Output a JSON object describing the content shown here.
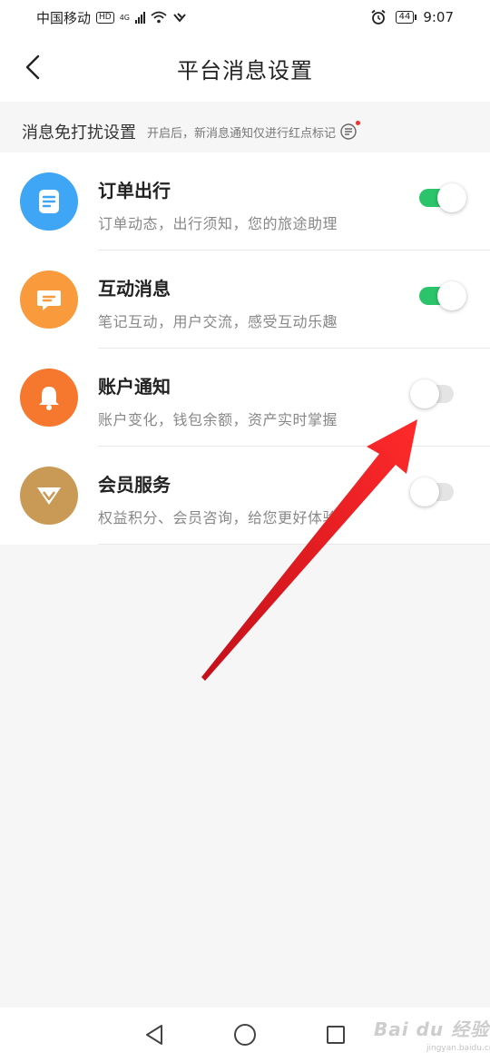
{
  "status_bar": {
    "carrier": "中国移动",
    "hd": "HD",
    "network": "4G",
    "battery": "44",
    "time": "9:07"
  },
  "header": {
    "title": "平台消息设置"
  },
  "section": {
    "title": "消息免打扰设置",
    "note": "开启后，新消息通知仅进行红点标记"
  },
  "items": [
    {
      "title": "订单出行",
      "desc": "订单动态，出行须知，您的旅途助理",
      "enabled": true,
      "icon": "document-icon",
      "color": "#3ea6f5"
    },
    {
      "title": "互动消息",
      "desc": "笔记互动，用户交流，感受互动乐趣",
      "enabled": true,
      "icon": "chat-icon",
      "color": "#f99a3c"
    },
    {
      "title": "账户通知",
      "desc": "账户变化，钱包余额，资产实时掌握",
      "enabled": false,
      "icon": "bell-icon",
      "color": "#f6782f"
    },
    {
      "title": "会员服务",
      "desc": "权益积分、会员咨询，给您更好体验",
      "enabled": false,
      "icon": "vip-diamond-icon",
      "color": "#c99a56"
    }
  ],
  "watermark": {
    "brand": "Bai du 经验",
    "url": "jingyan.baidu.com"
  },
  "colors": {
    "toggle_on": "#2bc46a",
    "toggle_off": "#e4e4e4",
    "arrow": "#e8141c"
  }
}
